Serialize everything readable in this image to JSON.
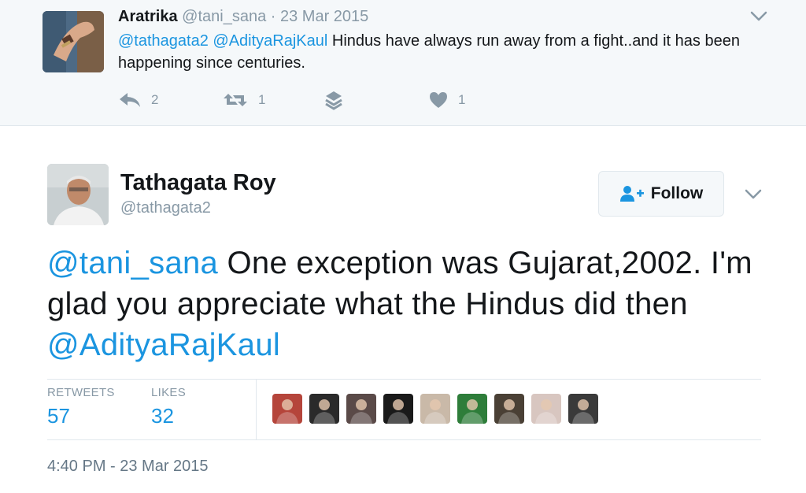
{
  "parent_tweet": {
    "display_name": "Aratrika",
    "handle": "@tani_sana",
    "separator": " · ",
    "date": "23 Mar 2015",
    "mention1": "@tathagata2",
    "mention2": "@AdityaRajKaul",
    "text": " Hindus have always run away from a fight..and it has been happening since centuries.",
    "actions": {
      "reply_count": "2",
      "retweet_count": "1",
      "like_count": "1"
    },
    "icons": [
      "reply-icon",
      "retweet-icon",
      "stack-icon",
      "heart-icon",
      "chevron-down-icon"
    ]
  },
  "main_tweet": {
    "display_name": "Tathagata Roy",
    "handle": "@tathagata2",
    "follow_label": "Follow",
    "mention1": "@tani_sana",
    "text": " One exception was Gujarat,2002. I'm glad you appreciate what the Hindus did then ",
    "mention2": "@AdityaRajKaul",
    "stats": {
      "retweets_label": "RETWEETS",
      "retweets_value": "57",
      "likes_label": "LIKES",
      "likes_value": "32"
    },
    "liker_avatars": [
      {
        "color": "#b5453b"
      },
      {
        "color": "#2a2a2a"
      },
      {
        "color": "#5a4a48"
      },
      {
        "color": "#1a1a1a"
      },
      {
        "color": "#c9b9a8"
      },
      {
        "color": "#2e7d3a"
      },
      {
        "color": "#4a4035"
      },
      {
        "color": "#d8c6c0"
      },
      {
        "color": "#3a3a3a"
      }
    ],
    "timestamp": "4:40 PM - 23 Mar 2015"
  },
  "colors": {
    "link": "#1b95e0",
    "muted": "#8899a6",
    "text": "#14171a",
    "parent_bg": "#f5f8fa",
    "border": "#e1e8ed"
  }
}
